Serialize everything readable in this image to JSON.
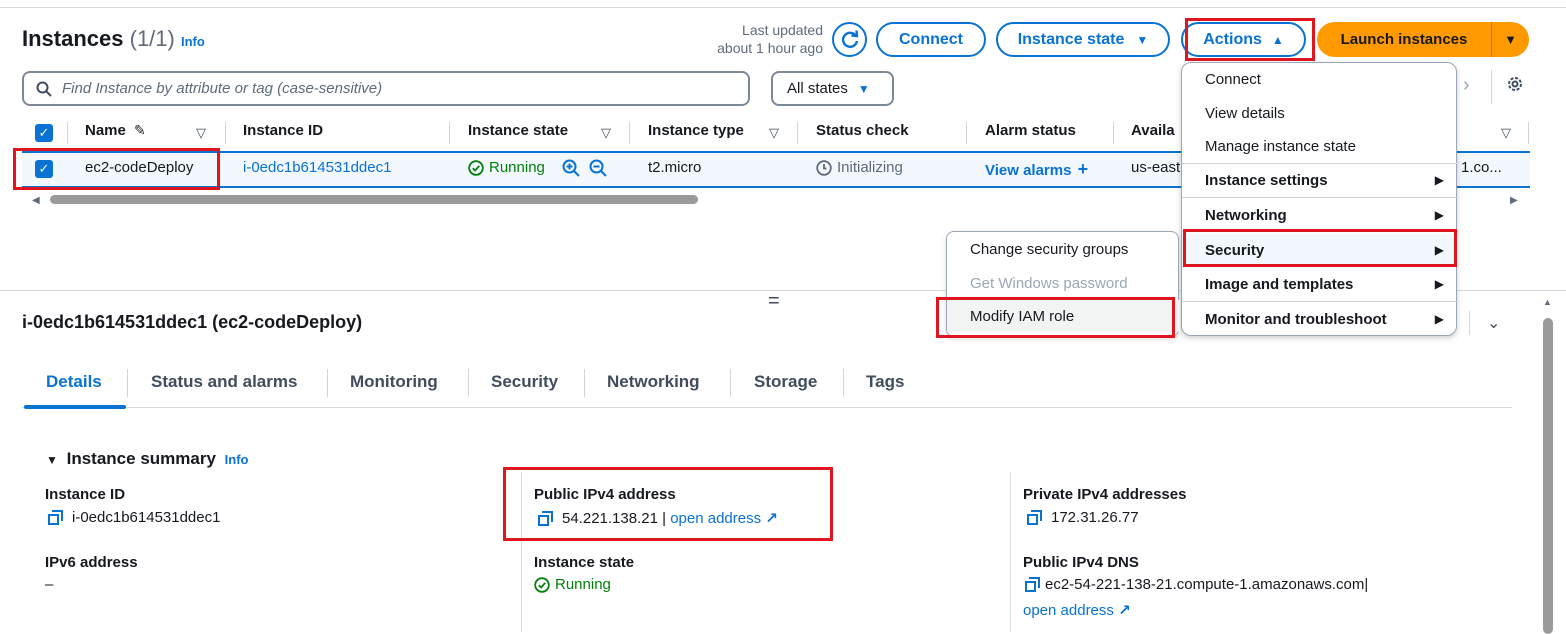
{
  "header": {
    "title": "Instances",
    "count": "(1/1)",
    "info": "Info",
    "last_updated_line1": "Last updated",
    "last_updated_line2": "about 1 hour ago",
    "connect": "Connect",
    "instance_state": "Instance state",
    "actions": "Actions",
    "launch": "Launch instances"
  },
  "filter": {
    "search_placeholder": "Find Instance by attribute or tag (case-sensitive)",
    "states": "All states"
  },
  "table": {
    "columns": [
      "Name",
      "Instance ID",
      "Instance state",
      "Instance type",
      "Status check",
      "Alarm status",
      "Availa"
    ],
    "row": {
      "name": "ec2-codeDeploy",
      "id": "i-0edc1b614531ddec1",
      "state": "Running",
      "type": "t2.micro",
      "status": "Initializing",
      "alarm": "View alarms",
      "az": "us-east",
      "extra": "1.co..."
    }
  },
  "actions_menu": {
    "items": [
      "Connect",
      "View details",
      "Manage instance state",
      "Instance settings",
      "Networking",
      "Security",
      "Image and templates",
      "Monitor and troubleshoot"
    ]
  },
  "security_submenu": {
    "items": [
      "Change security groups",
      "Get Windows password",
      "Modify IAM role"
    ]
  },
  "details": {
    "title": "i-0edc1b614531ddec1 (ec2-codeDeploy)",
    "tabs": [
      "Details",
      "Status and alarms",
      "Monitoring",
      "Security",
      "Networking",
      "Storage",
      "Tags"
    ],
    "summary_title": "Instance summary",
    "summary_info": "Info",
    "instance_id_label": "Instance ID",
    "instance_id": "i-0edc1b614531ddec1",
    "ipv6_label": "IPv6 address",
    "ipv6": "–",
    "public_ipv4_label": "Public IPv4 address",
    "public_ipv4": "54.221.138.21",
    "sep": "|",
    "open_address": "open address",
    "state_label": "Instance state",
    "state": "Running",
    "private_label": "Private IPv4 addresses",
    "private": "172.31.26.77",
    "dns_label": "Public IPv4 DNS",
    "dns": "ec2-54-221-138-21.compute-1.amazonaws.com",
    "dns_sep": "|",
    "dns_open": "open address"
  },
  "colors": {
    "accent": "#0972d3",
    "launch": "#ff9900",
    "highlight": "#e0161f",
    "success": "#037f0c"
  }
}
